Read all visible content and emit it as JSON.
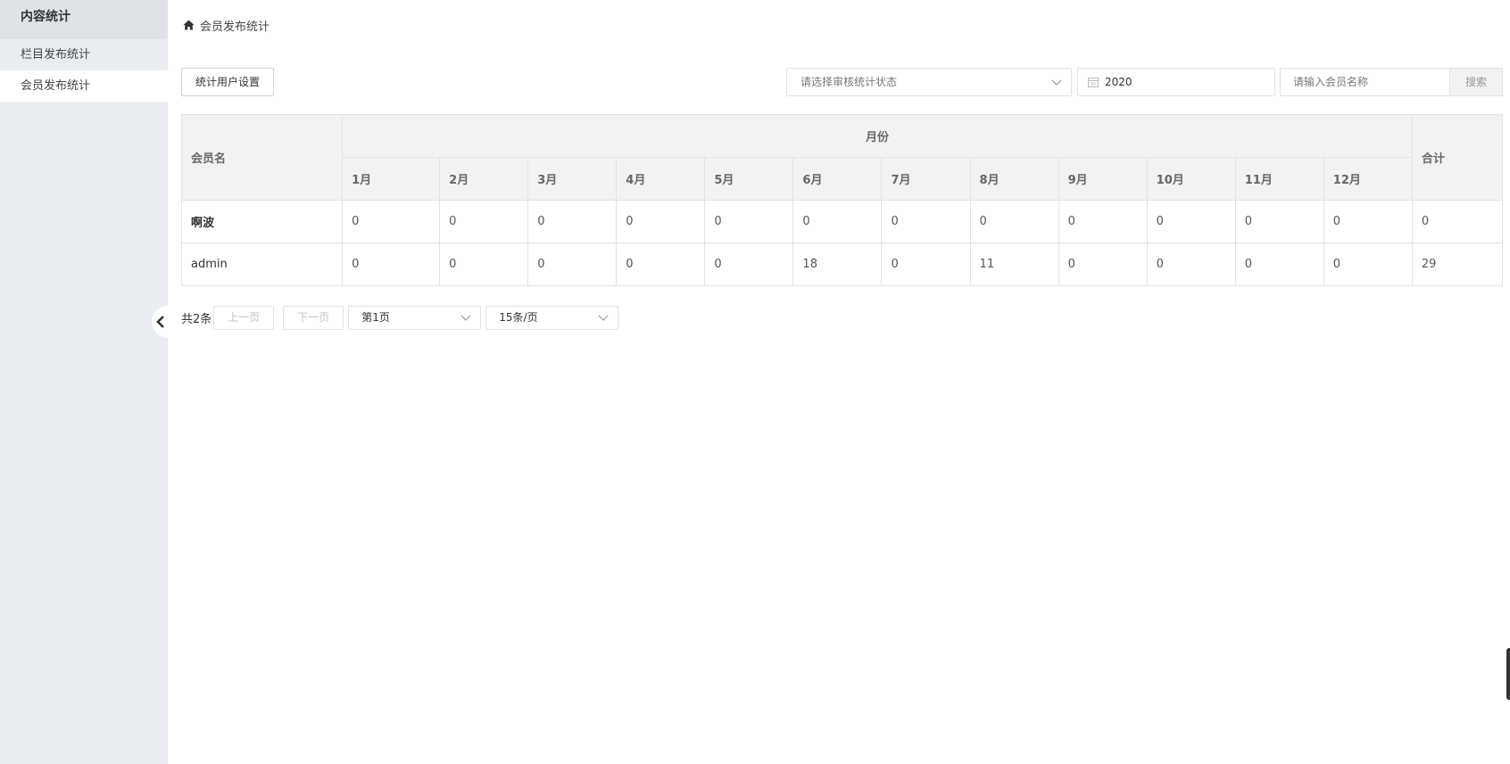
{
  "sidebar": {
    "title": "内容统计",
    "items": [
      {
        "label": "栏目发布统计"
      },
      {
        "label": "会员发布统计"
      }
    ]
  },
  "breadcrumb": {
    "label": "会员发布统计"
  },
  "toolbar": {
    "settings_button": "统计用户设置",
    "status_select_placeholder": "请选择审核统计状态",
    "year_value": "2020",
    "member_search_placeholder": "请输入会员名称",
    "search_button": "搜索"
  },
  "table": {
    "name_header": "会员名",
    "month_group_header": "月份",
    "total_header": "合计",
    "months": [
      "1月",
      "2月",
      "3月",
      "4月",
      "5月",
      "6月",
      "7月",
      "8月",
      "9月",
      "10月",
      "11月",
      "12月"
    ],
    "rows": [
      {
        "name": "啊波",
        "values": [
          "0",
          "0",
          "0",
          "0",
          "0",
          "0",
          "0",
          "0",
          "0",
          "0",
          "0",
          "0"
        ],
        "total": "0"
      },
      {
        "name": "admin",
        "values": [
          "0",
          "0",
          "0",
          "0",
          "0",
          "18",
          "0",
          "11",
          "0",
          "0",
          "0",
          "0"
        ],
        "total": "29"
      }
    ]
  },
  "pager": {
    "count_text": "共2条",
    "prev_label": "上一页",
    "next_label": "下一页",
    "page_select": "第1页",
    "size_select": "15条/页"
  }
}
